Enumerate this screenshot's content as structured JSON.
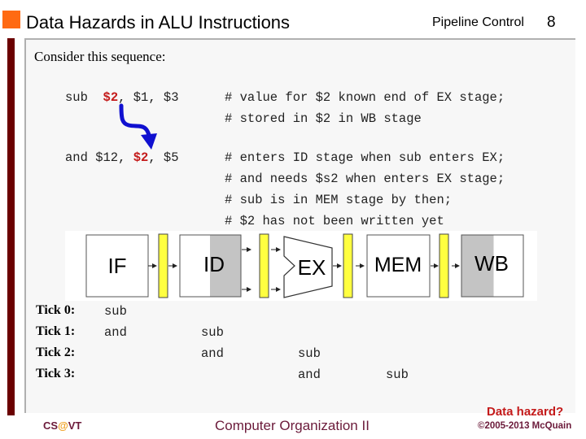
{
  "header": {
    "title": "Data Hazards in ALU Instructions",
    "section": "Pipeline Control",
    "page_number": "8"
  },
  "intro": "Consider this sequence:",
  "code": {
    "line1": {
      "op": "sub  ",
      "reg_dest": "$2",
      "rest": ", $1, $3",
      "comments": [
        "# value for $2 known end of EX stage;",
        "# stored in $2 in WB stage"
      ]
    },
    "line2": {
      "op": "and $12, ",
      "reg_src": "$2",
      "rest": ", $5",
      "comments": [
        "# enters ID stage when sub enters EX;",
        "# and needs $s2 when enters EX stage;",
        "# sub is in MEM stage by then;",
        "# $2 has not been written yet"
      ]
    }
  },
  "pipeline": {
    "stages": [
      "IF",
      "ID",
      "EX",
      "MEM",
      "WB"
    ]
  },
  "ticks": [
    {
      "label": "Tick 0:",
      "IF": "sub",
      "ID": "",
      "EX": "",
      "MEM": ""
    },
    {
      "label": "Tick 1:",
      "IF": "and",
      "ID": "sub",
      "EX": "",
      "MEM": ""
    },
    {
      "label": "Tick 2:",
      "IF": "",
      "ID": "and",
      "EX": "sub",
      "MEM": ""
    },
    {
      "label": "Tick 3:",
      "IF": "",
      "ID": "",
      "EX": "and",
      "MEM": "sub"
    }
  ],
  "annotation": "Data hazard?",
  "footer": {
    "left_cs": "CS",
    "left_at": "@",
    "left_vt": "VT",
    "center": "Computer Organization II",
    "right": "©2005-2013 McQuain"
  },
  "colors": {
    "accent_orange": "#ff6a13",
    "maroon": "#6b0000",
    "register_red": "#c41a1a",
    "arrow_blue": "#1010d0",
    "pipeline_register_yellow": "#ffff40",
    "footer_text": "#6b1a3a"
  }
}
